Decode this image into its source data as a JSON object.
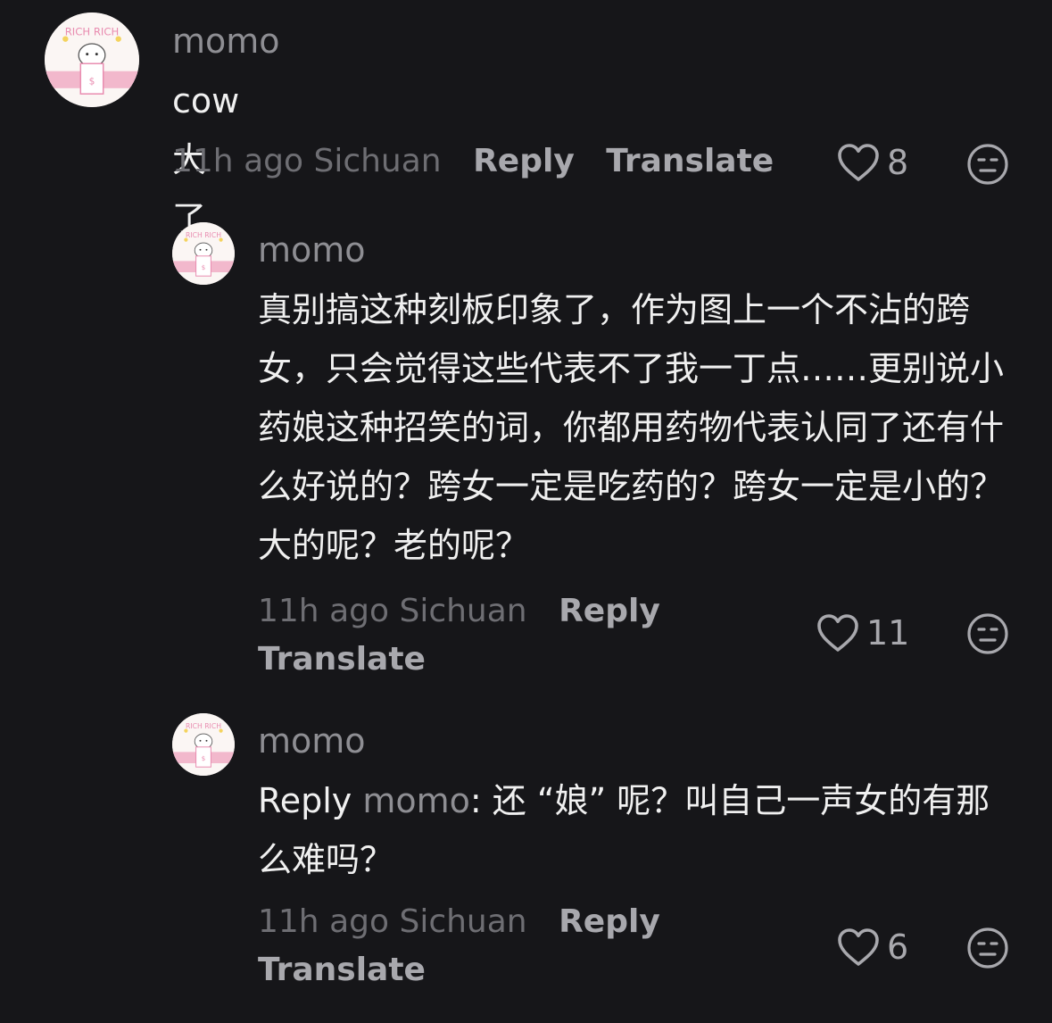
{
  "comments": [
    {
      "username": "momo",
      "avatar_text": "RICH RICH",
      "text": "cow大了",
      "time": "11h ago",
      "location": "Sichuan",
      "reply_label": "Reply",
      "translate_label": "Translate",
      "likes": "8"
    },
    {
      "username": "momo",
      "avatar_text": "RICH RICH",
      "text": "真别搞这种刻板印象了，作为图上一个不沾的跨女，只会觉得这些代表不了我一丁点……更别说小药娘这种招笑的词，你都用药物代表认同了还有什么好说的？跨女一定是吃药的？跨女一定是小的？大的呢？老的呢？",
      "time": "11h ago",
      "location": "Sichuan",
      "reply_label": "Reply",
      "translate_label": "Translate",
      "likes": "11"
    },
    {
      "username": "momo",
      "avatar_text": "RICH RICH",
      "reply_prefix": "Reply",
      "reply_to": "momo",
      "text": ": 还 “娘” 呢？叫自己一声女的有那么难吗？",
      "time": "11h ago",
      "location": "Sichuan",
      "reply_label": "Reply",
      "translate_label": "Translate",
      "likes": "6"
    }
  ],
  "colors": {
    "background": "#161619",
    "text": "#f0f0f0",
    "muted": "#6e6e73",
    "action": "#a8a8ad"
  },
  "icons": [
    "heart-icon",
    "meh-face-icon"
  ]
}
